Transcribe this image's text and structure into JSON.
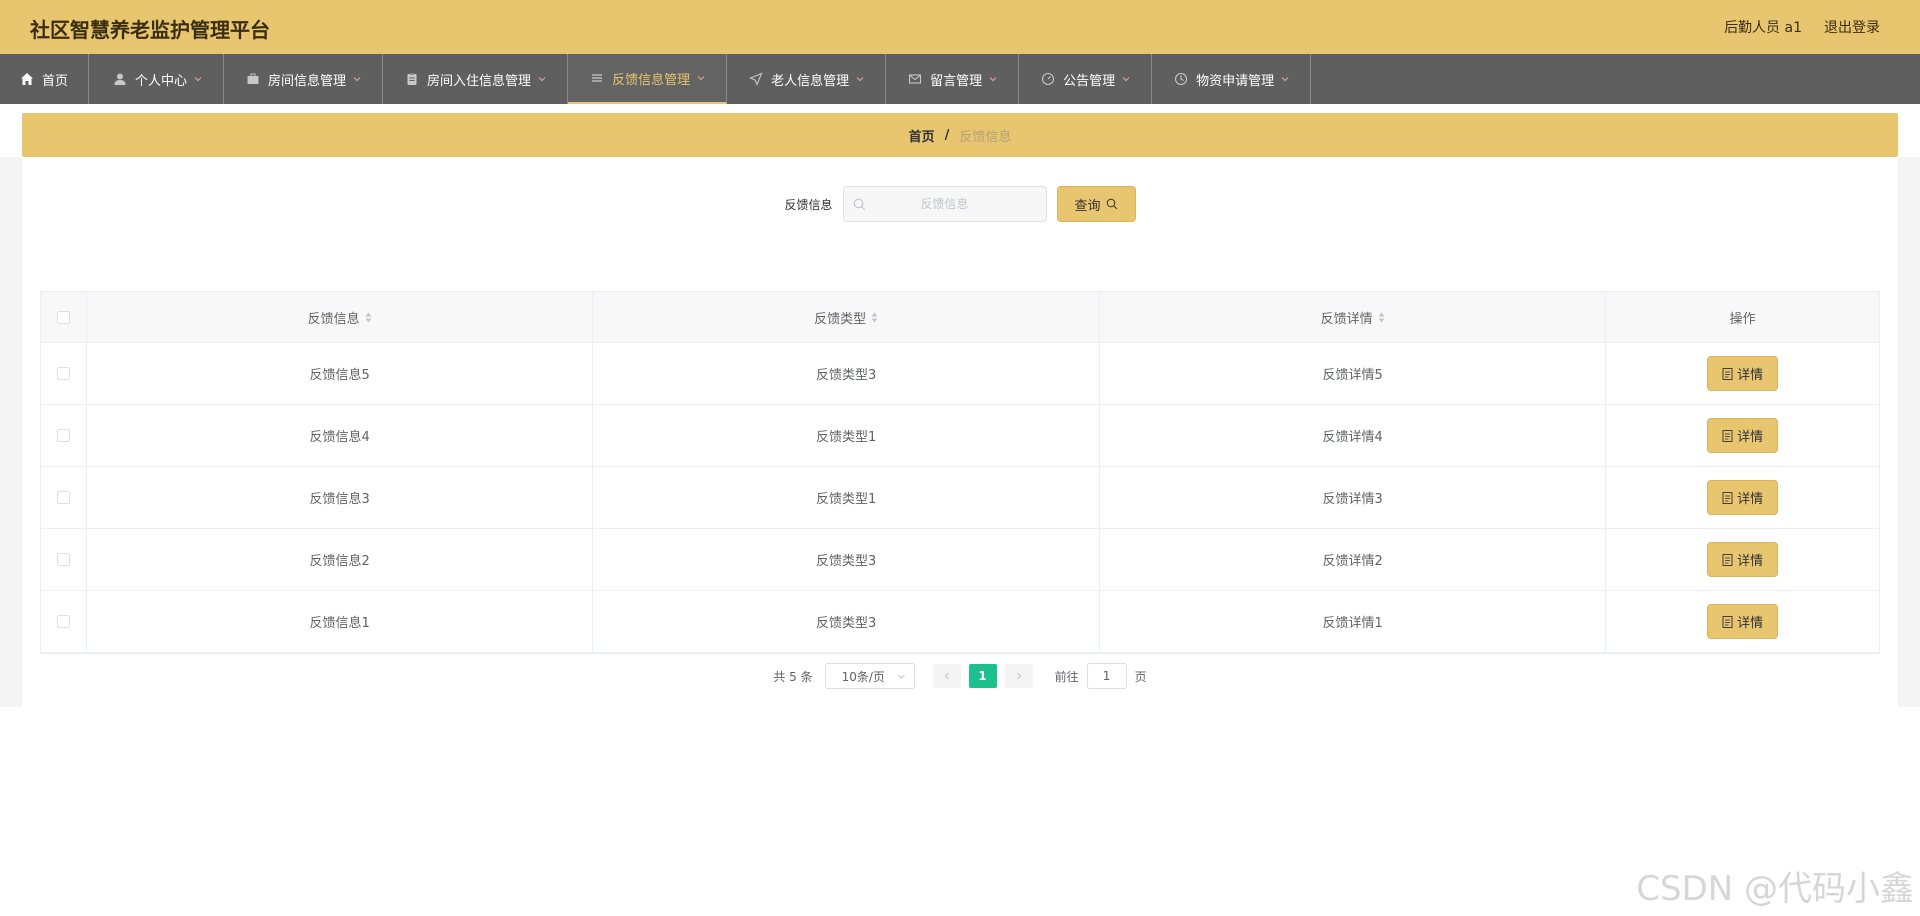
{
  "header": {
    "title": "社区智慧养老监护管理平台",
    "user_label": "后勤人员 a1",
    "logout_label": "退出登录"
  },
  "nav": {
    "items": [
      {
        "label": "首页",
        "icon": "home-icon",
        "has_caret": false
      },
      {
        "label": "个人中心",
        "icon": "user-icon",
        "has_caret": true
      },
      {
        "label": "房间信息管理",
        "icon": "briefcase-icon",
        "has_caret": true
      },
      {
        "label": "房间入住信息管理",
        "icon": "clipboard-icon",
        "has_caret": true
      },
      {
        "label": "反馈信息管理",
        "icon": "menu-icon",
        "has_caret": true,
        "active": true
      },
      {
        "label": "老人信息管理",
        "icon": "send-icon",
        "has_caret": true
      },
      {
        "label": "留言管理",
        "icon": "mail-icon",
        "has_caret": true
      },
      {
        "label": "公告管理",
        "icon": "gauge-icon",
        "has_caret": true
      },
      {
        "label": "物资申请管理",
        "icon": "clock-icon",
        "has_caret": true
      }
    ]
  },
  "breadcrumb": {
    "home": "首页",
    "separator": "/",
    "current": "反馈信息"
  },
  "search": {
    "label": "反馈信息",
    "placeholder": "反馈信息",
    "value": "",
    "button_label": "查询"
  },
  "table": {
    "headers": [
      "反馈信息",
      "反馈类型",
      "反馈详情",
      "操作"
    ],
    "rows": [
      {
        "info": "反馈信息5",
        "type": "反馈类型3",
        "detail": "反馈详情5"
      },
      {
        "info": "反馈信息4",
        "type": "反馈类型1",
        "detail": "反馈详情4"
      },
      {
        "info": "反馈信息3",
        "type": "反馈类型1",
        "detail": "反馈详情3"
      },
      {
        "info": "反馈信息2",
        "type": "反馈类型3",
        "detail": "反馈详情2"
      },
      {
        "info": "反馈信息1",
        "type": "反馈类型3",
        "detail": "反馈详情1"
      }
    ],
    "action_label": "详情"
  },
  "pagination": {
    "total": "共 5 条",
    "page_size": "10条/页",
    "current_page": "1",
    "goto_label": "前往",
    "goto_value": "1",
    "goto_suffix": "页"
  },
  "watermark": "CSDN @代码小鑫",
  "colors": {
    "accent": "#e8c56f",
    "nav_bg": "#5f5f5f",
    "page_active": "#1cbf8e"
  }
}
